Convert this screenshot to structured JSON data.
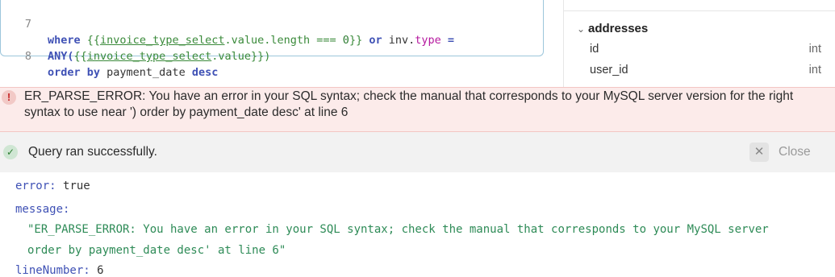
{
  "editor": {
    "lines": [
      {
        "number": "7",
        "kw_where": "where",
        "open1": "{{",
        "var1": "invoice_type_select",
        "prop1": ".value.length",
        "op": " === ",
        "num": "0",
        "close1": "}}",
        "kw_or": " or ",
        "inv": "inv",
        "dot": ".",
        "type": "type",
        "eq": " ="
      },
      {
        "number": "",
        "any": "ANY(",
        "open2": "{{",
        "var2": "invoice_type_select",
        "prop2": ".value",
        "close2": "}})"
      },
      {
        "number": "8",
        "kw_order": "order by",
        "field": " payment_date ",
        "kw_desc": "desc"
      }
    ]
  },
  "schema": {
    "table_name": "addresses",
    "columns": [
      {
        "name": "id",
        "type": "int"
      },
      {
        "name": "user_id",
        "type": "int"
      }
    ]
  },
  "error": {
    "icon": "!",
    "message": "ER_PARSE_ERROR: You have an error in your SQL syntax; check the manual that corresponds to your MySQL server version for the right syntax to use near ') order by payment_date desc' at line 6"
  },
  "status": {
    "icon": "✓",
    "message": "Query ran successfully.",
    "close_icon": "✕",
    "close_label": "Close"
  },
  "result": {
    "error_key": "error:",
    "error_val": "true",
    "message_key": "message:",
    "message_line1": "\"ER_PARSE_ERROR: You have an error in your SQL syntax; check the manual that corresponds to your MySQL server",
    "message_line2": "order by payment_date desc' at line 6\"",
    "linenumber_key": "lineNumber:",
    "linenumber_val": "6"
  },
  "colors": {
    "error_bg": "#fcebea",
    "success_bg": "#f2f2f2",
    "keyword": "#3f51b5",
    "template": "#3a8a3a",
    "string": "#2e8b57"
  }
}
